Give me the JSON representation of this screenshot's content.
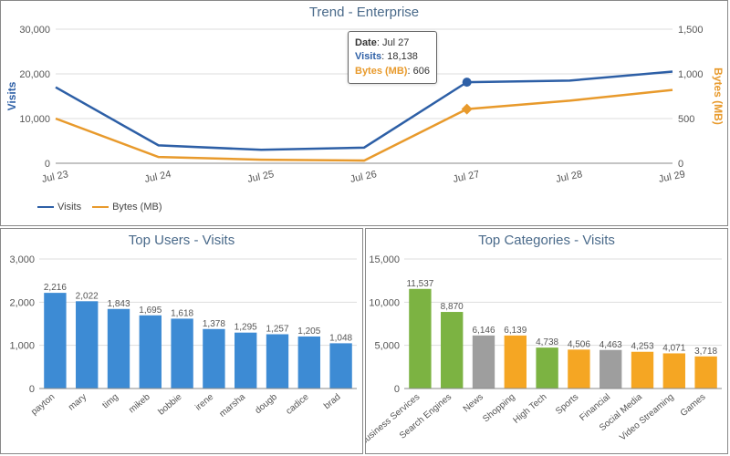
{
  "chart_data": [
    {
      "id": "trend",
      "type": "line",
      "title": "Trend - Enterprise",
      "xlabel": "",
      "categories": [
        "Jul 23",
        "Jul 24",
        "Jul 25",
        "Jul 26",
        "Jul 27",
        "Jul 28",
        "Jul 29"
      ],
      "axes": {
        "left": {
          "label": "Visits",
          "ticks": [
            0,
            10000,
            20000,
            30000
          ],
          "tick_labels": [
            "0",
            "10,000",
            "20,000",
            "30,000"
          ],
          "color": "#2d5fa6"
        },
        "right": {
          "label": "Bytes (MB)",
          "ticks": [
            0,
            500,
            1000,
            1500
          ],
          "tick_labels": [
            "0",
            "500",
            "1,000",
            "1,500"
          ],
          "color": "#e89a2c"
        }
      },
      "series": [
        {
          "name": "Visits",
          "axis": "left",
          "color": "#2d5fa6",
          "values": [
            17000,
            4000,
            3000,
            3500,
            18138,
            18500,
            20500
          ]
        },
        {
          "name": "Bytes (MB)",
          "axis": "right",
          "color": "#e89a2c",
          "values": [
            500,
            70,
            40,
            30,
            606,
            700,
            820
          ]
        }
      ],
      "tooltip": {
        "date_key": "Date",
        "date_val": "Jul 27",
        "visits_key": "Visits",
        "visits_val": "18,138",
        "bytes_key": "Bytes (MB)",
        "bytes_val": "606",
        "at_index": 4
      },
      "legend": [
        "Visits",
        "Bytes (MB)"
      ]
    },
    {
      "id": "top_users",
      "type": "bar",
      "title": "Top Users - Visits",
      "categories": [
        "payton",
        "mary",
        "timg",
        "mikeb",
        "bobbie",
        "irene",
        "marsha",
        "dougb",
        "cadice",
        "brad"
      ],
      "values": [
        2216,
        2022,
        1843,
        1695,
        1618,
        1378,
        1295,
        1257,
        1205,
        1048
      ],
      "value_labels": [
        "2,216",
        "2,022",
        "1,843",
        "1,695",
        "1,618",
        "1,378",
        "1,295",
        "1,257",
        "1,205",
        "1,048"
      ],
      "yticks": [
        0,
        1000,
        2000,
        3000
      ],
      "ytick_labels": [
        "0",
        "1,000",
        "2,000",
        "3,000"
      ],
      "color": "#3d8bd4"
    },
    {
      "id": "top_categories",
      "type": "bar",
      "title": "Top Categories - Visits",
      "categories": [
        "Business Services",
        "Search Engines",
        "News",
        "Shopping",
        "High Tech",
        "Sports",
        "Financial",
        "Social Media",
        "Video Streaming",
        "Games"
      ],
      "values": [
        11537,
        8870,
        6146,
        6139,
        4738,
        4506,
        4463,
        4253,
        4071,
        3718
      ],
      "value_labels": [
        "11,537",
        "8,870",
        "6,146",
        "6,139",
        "4,738",
        "4,506",
        "4,463",
        "4,253",
        "4,071",
        "3,718"
      ],
      "yticks": [
        0,
        5000,
        10000,
        15000
      ],
      "ytick_labels": [
        "0",
        "5,000",
        "10,000",
        "15,000"
      ],
      "colors": [
        "#7cb342",
        "#7cb342",
        "#9e9e9e",
        "#f5a623",
        "#7cb342",
        "#f5a623",
        "#9e9e9e",
        "#f5a623",
        "#f5a623",
        "#f5a623"
      ]
    }
  ]
}
